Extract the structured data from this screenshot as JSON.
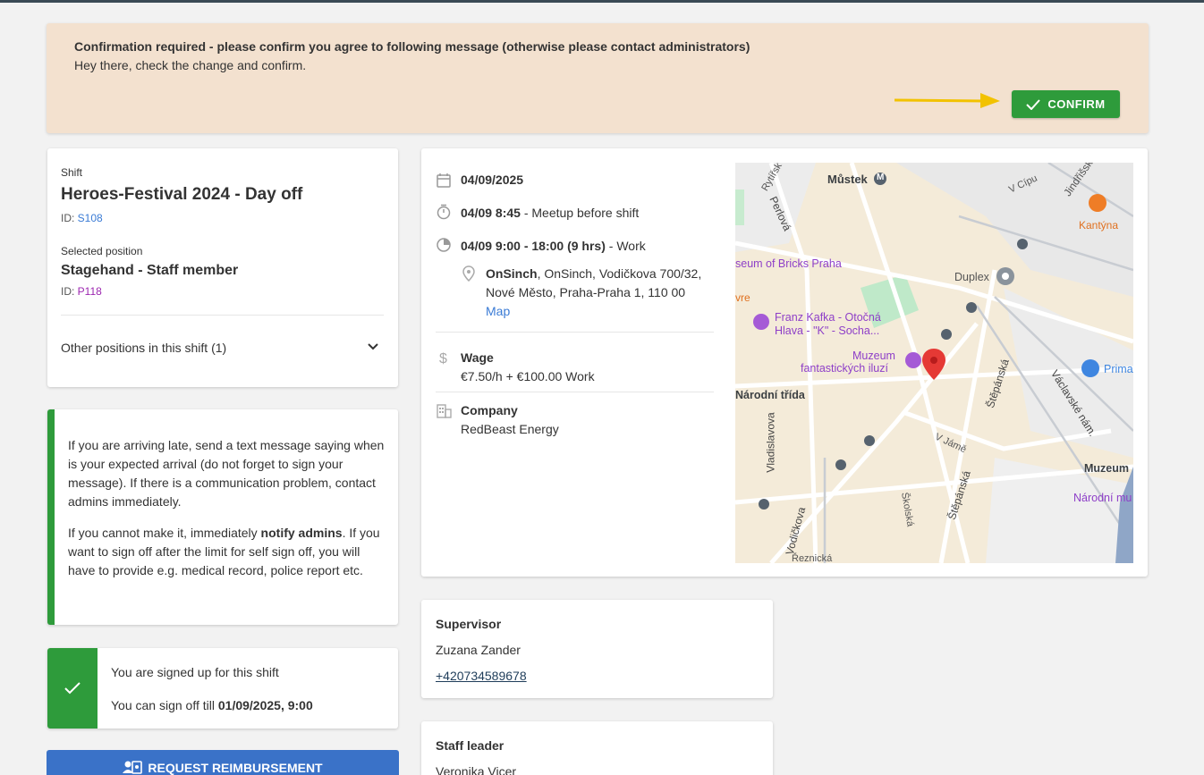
{
  "colors": {
    "confirm": "#2e9b3b",
    "banner": "#f3e1cf",
    "reimburse": "#3a72c8",
    "link": "#3a7bd5"
  },
  "banner": {
    "title": "Confirmation required - please confirm you agree to following message (otherwise please contact administrators)",
    "message": "Hey there, check the change and confirm.",
    "confirm_label": "CONFIRM"
  },
  "shift": {
    "section_label": "Shift",
    "name": "Heroes-Festival 2024 - Day off",
    "id_prefix": "ID: ",
    "id": "S108",
    "position_label": "Selected position",
    "position_name": "Stagehand - Staff member",
    "position_id": "P118",
    "other_positions": "Other positions in this shift (1)"
  },
  "info": {
    "p1": "If you are arriving late, send a text message saying when is your expected arrival (do not forget to sign your message). If there is a communication problem, contact admins immediately.",
    "p2_pre": "If you cannot make it, immediately ",
    "p2_bold": "notify admins",
    "p2_post": ". If you want to sign off after the limit for self sign off, you will have to provide e.g. medical record, police report etc."
  },
  "signup": {
    "status": "You are signed up for this shift",
    "signoff_pre": "You can sign off till ",
    "signoff_date": "01/09/2025, 9:00"
  },
  "reimburse_label": "REQUEST REIMBURSEMENT",
  "details": {
    "date": "04/09/2025",
    "meetup_time": "04/09 8:45",
    "meetup_label": " - Meetup before shift",
    "work_time": "04/09 9:00 - 18:00 (9 hrs)",
    "work_label": " - Work",
    "location_name": "OnSinch",
    "location_addr1": ", OnSinch, Vodičkova 700/32,",
    "location_addr2": "Nové Město, Praha-Praha 1, 110 00",
    "map_link": "Map",
    "wage_label": "Wage",
    "wage_value": "€7.50/h + €100.00 Work",
    "company_label": "Company",
    "company_value": "RedBeast Energy"
  },
  "map_labels": {
    "mustek": "Můstek",
    "m": "M",
    "rytirska": "Rytířsk",
    "perlova": "Perlová",
    "vcipu": "V Cípu",
    "jindrisska": "Jindřišsk",
    "kantyna": "Kantýna",
    "bricks": "seum of Bricks Praha",
    "duplex": "Duplex",
    "vre": "vre",
    "kafka1": "Franz Kafka - Otočná",
    "kafka2": "Hlava - \"K\" - Socha...",
    "muzeum1": "Muzeum",
    "muzeum2": "fantastických iluzí",
    "stepanska1": "Štěpánská",
    "vaclavske": "Václavské nám.",
    "prima": "Prima",
    "narodni": "Národní třída",
    "vladislavova": "Vladislavova",
    "vjame": "V Jámě",
    "muzeum3": "Muzeum",
    "narodnimu": "Národní mu",
    "stepanska2": "Štěpánská",
    "skolska": "Školská",
    "vodickova": "Vodičkova",
    "reznicka": "Řeznická"
  },
  "supervisor": {
    "label": "Supervisor",
    "name": "Zuzana Zander",
    "phone": "+420734589678"
  },
  "staff_leader": {
    "label": "Staff leader",
    "name": "Veronika Vicer"
  }
}
